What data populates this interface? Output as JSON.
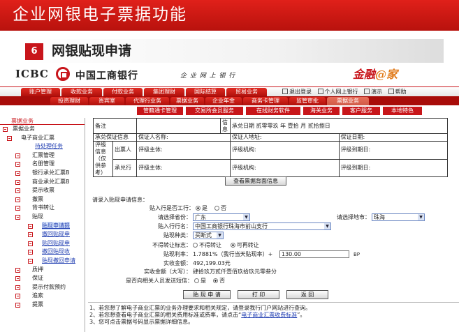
{
  "slide": {
    "title": "企业网银电子票据功能",
    "section_num": "6",
    "section_title": "网银贴现申请"
  },
  "bank": {
    "logo_text": "ICBC",
    "name": "中国工商银行",
    "subtitle": "企 业 网 上 银 行",
    "brand_a": "金融",
    "brand_b": "@家"
  },
  "nav_top": [
    "账户管理",
    "收款业务",
    "付款业务",
    "集团理财",
    "国际结算",
    "贸易业务"
  ],
  "toolbar": [
    "退出登录",
    "个人网上银行",
    "演示",
    "帮助"
  ],
  "nav_mid": [
    "投资理财",
    "贵宾室",
    "代理行业务",
    "票据业务",
    "企业年金",
    "商务卡管理",
    "监管审批",
    "票据业务"
  ],
  "nav_sub": [
    "管籍通卡管理",
    "交易所会员服务",
    "在线财务软件",
    "海关业务",
    "客户服务",
    "本地特色"
  ],
  "sidebar": {
    "header": "票据业务",
    "items": [
      "票据业务",
      "电子商业汇票",
      "待处理任务",
      "汇票管理",
      "名册管理",
      "银行承兑汇票B",
      "商业承兑汇票B",
      "提示收票",
      "撤票",
      "背书转让",
      "贴现",
      "贴现申请提",
      "撤回贴现申",
      "贴回贴现申",
      "撤回贴现收",
      "贴现撤回申请",
      "质押",
      "保证",
      "提示付款预约",
      "追索",
      "提票"
    ]
  },
  "info_table": {
    "r1_left": "备注",
    "r1_right_label": "信息",
    "r1_right_value": "承兑日期 贰零零玖 年 壹拾 月 贰拾捌日",
    "r2_label": "承兑保证信息",
    "r2_fields": [
      "保证人名称:",
      "保证人地址:",
      "保证日期:"
    ],
    "r3_label": "评级信息（仅供参考）",
    "r3_rows": [
      {
        "role": "出票人",
        "main": "评级主体:",
        "agency": "评级机构:",
        "due": "评级到期日:"
      },
      {
        "role": "承兑行",
        "main": "评级主体:",
        "agency": "评级机构:",
        "due": "评级到期日:"
      }
    ],
    "view_back_button": "查看票据背面信息"
  },
  "form": {
    "intro": "请录入贴现申请信息：",
    "same_bank_label": "贴入行是否工行：",
    "yes": "是",
    "no": "否",
    "province_label": "请选择省份：",
    "province_value": "广东",
    "city_label": "请选择地市：",
    "city_value": "珠海",
    "bank_label": "贴入行行名：",
    "bank_value": "中国工商银行珠海市前山支行",
    "kind_label": "贴现种类：",
    "kind_value": "买断式",
    "transfer_label": "不得转让标志：",
    "transfer_no": "不得转让",
    "transfer_yes": "可再转让",
    "rate_label": "贴现利率：",
    "rate_value": "1.7881%（我行当天贴现率）+",
    "rate_input": "130.00",
    "rate_unit": "BP",
    "actual_label": "实收金额：",
    "actual_value": "492,199.03元",
    "actual_cn_label": "实收金额（大写）：",
    "actual_cn_value": "肆拾玖万贰仟壹佰玖拾玖元零叁分",
    "send_label": "是否向相关人员发送短信：",
    "send_yes": "是",
    "send_no": "否",
    "submit_button": "贴 现 申 请",
    "print_button": "打 印",
    "back_button": "返 回"
  },
  "notes": {
    "n1": "1、若您想了解电子商业汇票的业务办理要求和相关规定，请登录我行门户网站进行查询。",
    "n2a": "2、若您想查看电子商业汇票的相关费用标准或费率，请点击“",
    "n2_link": "电子商业汇票收费标准",
    "n2b": "”。",
    "n3": "3、您可点击票据号码显示票据详细信息。"
  }
}
